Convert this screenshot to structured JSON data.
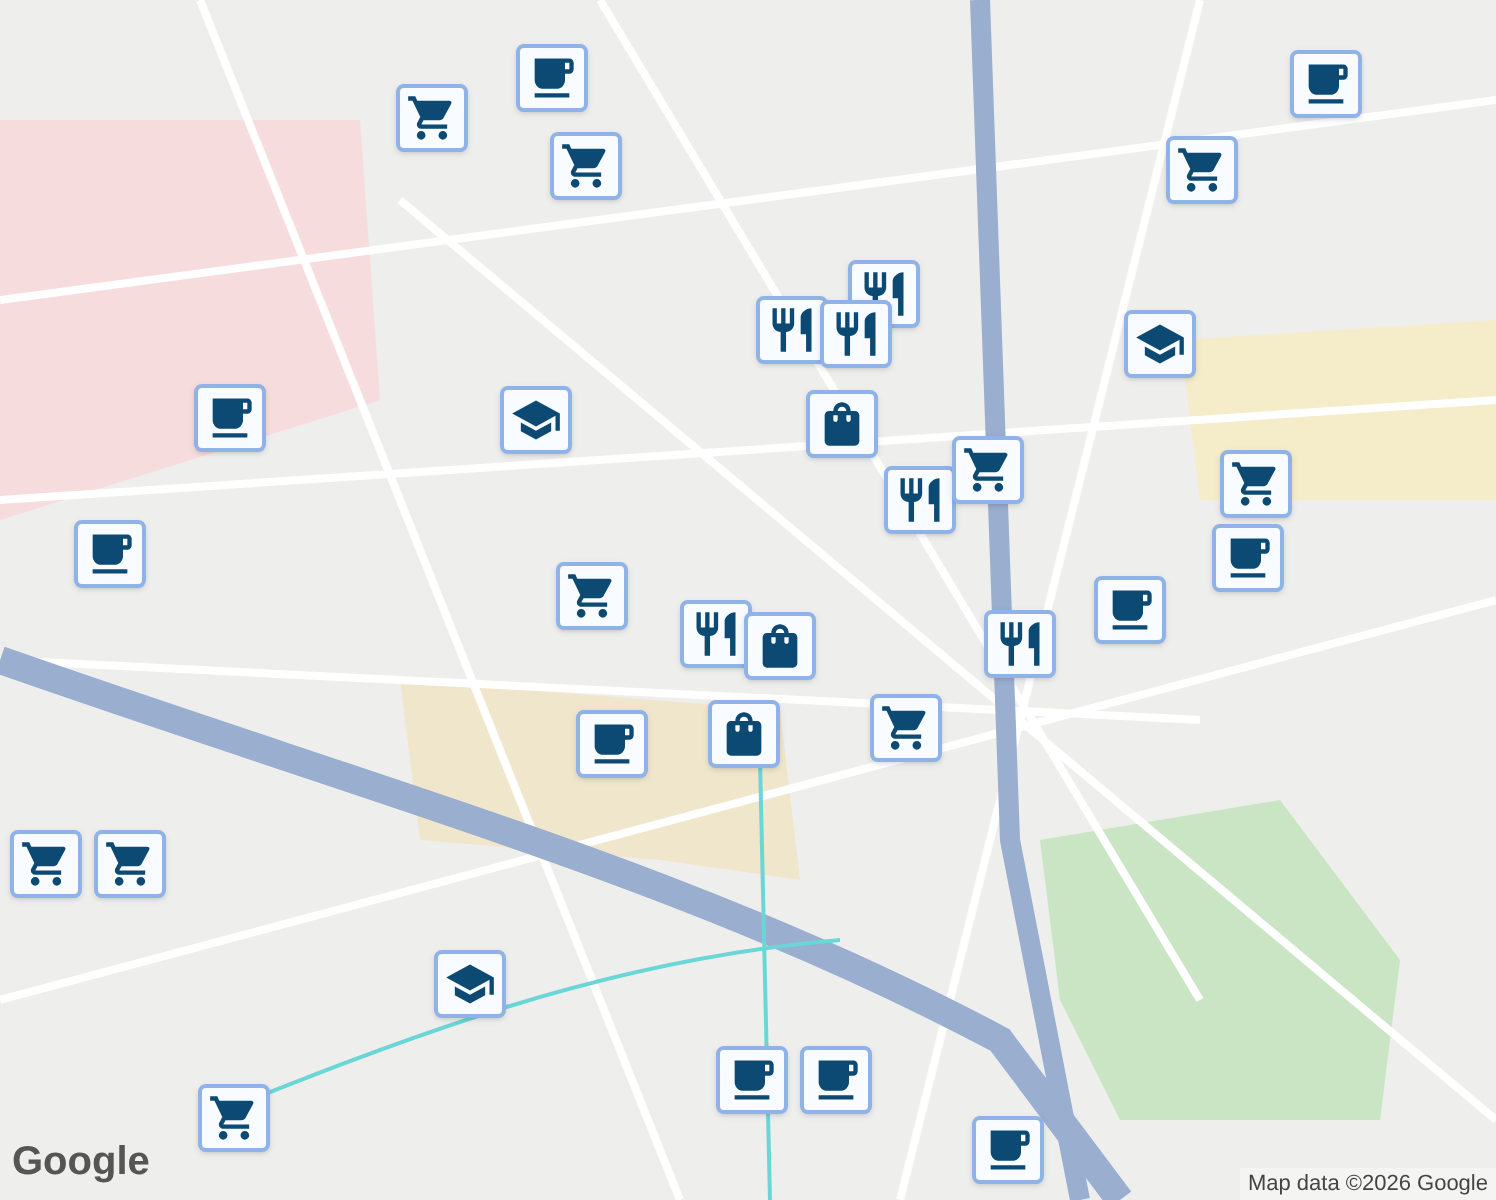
{
  "markers": [
    {
      "kind": "cafe"
    },
    {
      "kind": "cart"
    },
    {
      "kind": "cart"
    },
    {
      "kind": "cafe"
    },
    {
      "kind": "cart"
    },
    {
      "kind": "school"
    },
    {
      "kind": "restaurant"
    },
    {
      "kind": "restaurant"
    },
    {
      "kind": "restaurant"
    },
    {
      "kind": "bag"
    },
    {
      "kind": "restaurant"
    },
    {
      "kind": "cart"
    },
    {
      "kind": "cart"
    },
    {
      "kind": "cafe"
    },
    {
      "kind": "cafe"
    },
    {
      "kind": "school"
    },
    {
      "kind": "cafe"
    },
    {
      "kind": "cart"
    },
    {
      "kind": "restaurant"
    },
    {
      "kind": "bag"
    },
    {
      "kind": "cafe"
    },
    {
      "kind": "restaurant"
    },
    {
      "kind": "bag"
    },
    {
      "kind": "cafe"
    },
    {
      "kind": "cart"
    },
    {
      "kind": "cart"
    },
    {
      "kind": "cart"
    },
    {
      "kind": "school"
    },
    {
      "kind": "cart"
    },
    {
      "kind": "cafe"
    },
    {
      "kind": "cafe"
    },
    {
      "kind": "cafe"
    }
  ],
  "logo": "Google",
  "attribution": "Map data ©2026 Google"
}
